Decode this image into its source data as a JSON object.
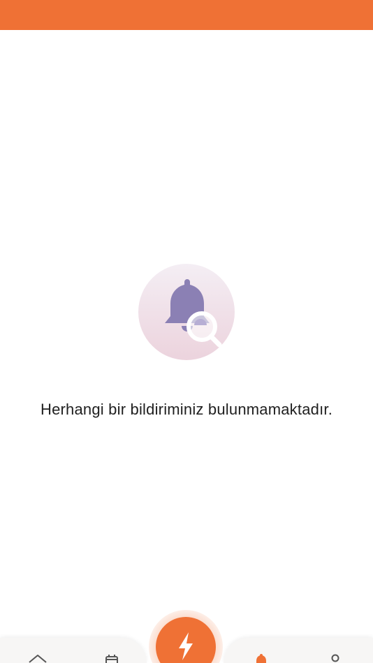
{
  "colors": {
    "accent": "#ef7135",
    "illustration_bell": "#8b80b4",
    "background": "#ffffff"
  },
  "empty_state": {
    "icon": "bell-search-icon",
    "message": "Herhangi bir bildiriminiz bulunmamaktadır."
  },
  "bottom_nav": {
    "items": [
      {
        "icon": "home-icon"
      },
      {
        "icon": "calendar-icon"
      },
      {
        "icon": "lightning-icon"
      },
      {
        "icon": "bell-icon",
        "active": true
      },
      {
        "icon": "profile-icon"
      }
    ]
  }
}
